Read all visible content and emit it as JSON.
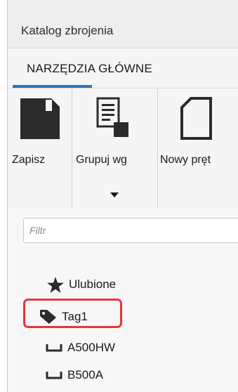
{
  "window": {
    "title": "Katalog zbrojenia"
  },
  "ribbon_tabs": [
    {
      "label": "NARZĘDZIA GŁÓWNE",
      "active": true
    }
  ],
  "ribbon_buttons": {
    "save": {
      "label": "Zapisz",
      "icon": "save-icon"
    },
    "group_by": {
      "label": "Grupuj wg",
      "icon": "group-list-icon",
      "has_dropdown": true
    },
    "new_bar": {
      "label": "Nowy pręt",
      "icon": "new-document-icon"
    }
  },
  "filter": {
    "placeholder": "Filtr",
    "value": ""
  },
  "tree": {
    "items": [
      {
        "label": "Ulubione",
        "icon": "star-icon"
      },
      {
        "label": "Tag1",
        "icon": "tag-icon",
        "highlighted": true
      },
      {
        "label": "A500HW",
        "icon": "rebar-hook-icon"
      },
      {
        "label": "B500A",
        "icon": "rebar-hook-icon"
      }
    ]
  },
  "colors": {
    "accent": "#2f73b8",
    "highlight": "#e8343a",
    "icon_dark": "#2b2b2b"
  }
}
